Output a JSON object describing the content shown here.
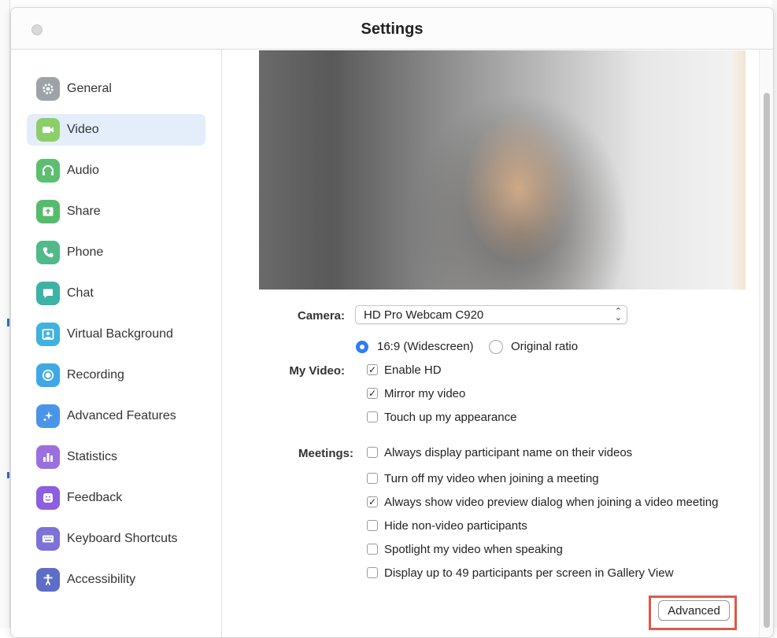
{
  "window": {
    "title": "Settings"
  },
  "sidebar": {
    "selected": "Video",
    "items": [
      {
        "label": "General",
        "icon": "gear-icon",
        "color": "#9ea3a8"
      },
      {
        "label": "Video",
        "icon": "video-camera-icon",
        "color": "#8ccf6a"
      },
      {
        "label": "Audio",
        "icon": "headphones-icon",
        "color": "#5cbf6f"
      },
      {
        "label": "Share",
        "icon": "share-screen-icon",
        "color": "#57bb6c"
      },
      {
        "label": "Phone",
        "icon": "phone-icon",
        "color": "#51b98a"
      },
      {
        "label": "Chat",
        "icon": "chat-bubble-icon",
        "color": "#3db3a6"
      },
      {
        "label": "Virtual Background",
        "icon": "person-frame-icon",
        "color": "#3fb2dd"
      },
      {
        "label": "Recording",
        "icon": "record-icon",
        "color": "#3ea8e8"
      },
      {
        "label": "Advanced Features",
        "icon": "sparkle-icon",
        "color": "#4a95e8"
      },
      {
        "label": "Statistics",
        "icon": "bar-chart-icon",
        "color": "#9b6fe0"
      },
      {
        "label": "Feedback",
        "icon": "smiley-icon",
        "color": "#8c5ee0"
      },
      {
        "label": "Keyboard Shortcuts",
        "icon": "keyboard-icon",
        "color": "#7e71d8"
      },
      {
        "label": "Accessibility",
        "icon": "accessibility-icon",
        "color": "#5d6ec8"
      }
    ]
  },
  "video": {
    "camera_label": "Camera:",
    "camera_value": "HD Pro Webcam C920",
    "aspect_options": [
      "16:9 (Widescreen)",
      "Original ratio"
    ],
    "aspect_selected": "16:9 (Widescreen)",
    "my_video_label": "My Video:",
    "my_video_options": [
      {
        "label": "Enable HD",
        "checked": true
      },
      {
        "label": "Mirror my video",
        "checked": true
      },
      {
        "label": "Touch up my appearance",
        "checked": false
      }
    ],
    "meetings_label": "Meetings:",
    "meeting_options": [
      {
        "label": "Always display participant name on their videos",
        "checked": false
      },
      {
        "label": "Turn off my video when joining a meeting",
        "checked": false
      },
      {
        "label": "Always show video preview dialog when joining a video meeting",
        "checked": true
      },
      {
        "label": "Hide non-video participants",
        "checked": false
      },
      {
        "label": "Spotlight my video when speaking",
        "checked": false
      },
      {
        "label": "Display up to 49 participants per screen in Gallery View",
        "checked": false
      }
    ],
    "advanced_button": "Advanced",
    "highlight_color": "#e0584c",
    "accent_color": "#2f7cf6"
  }
}
